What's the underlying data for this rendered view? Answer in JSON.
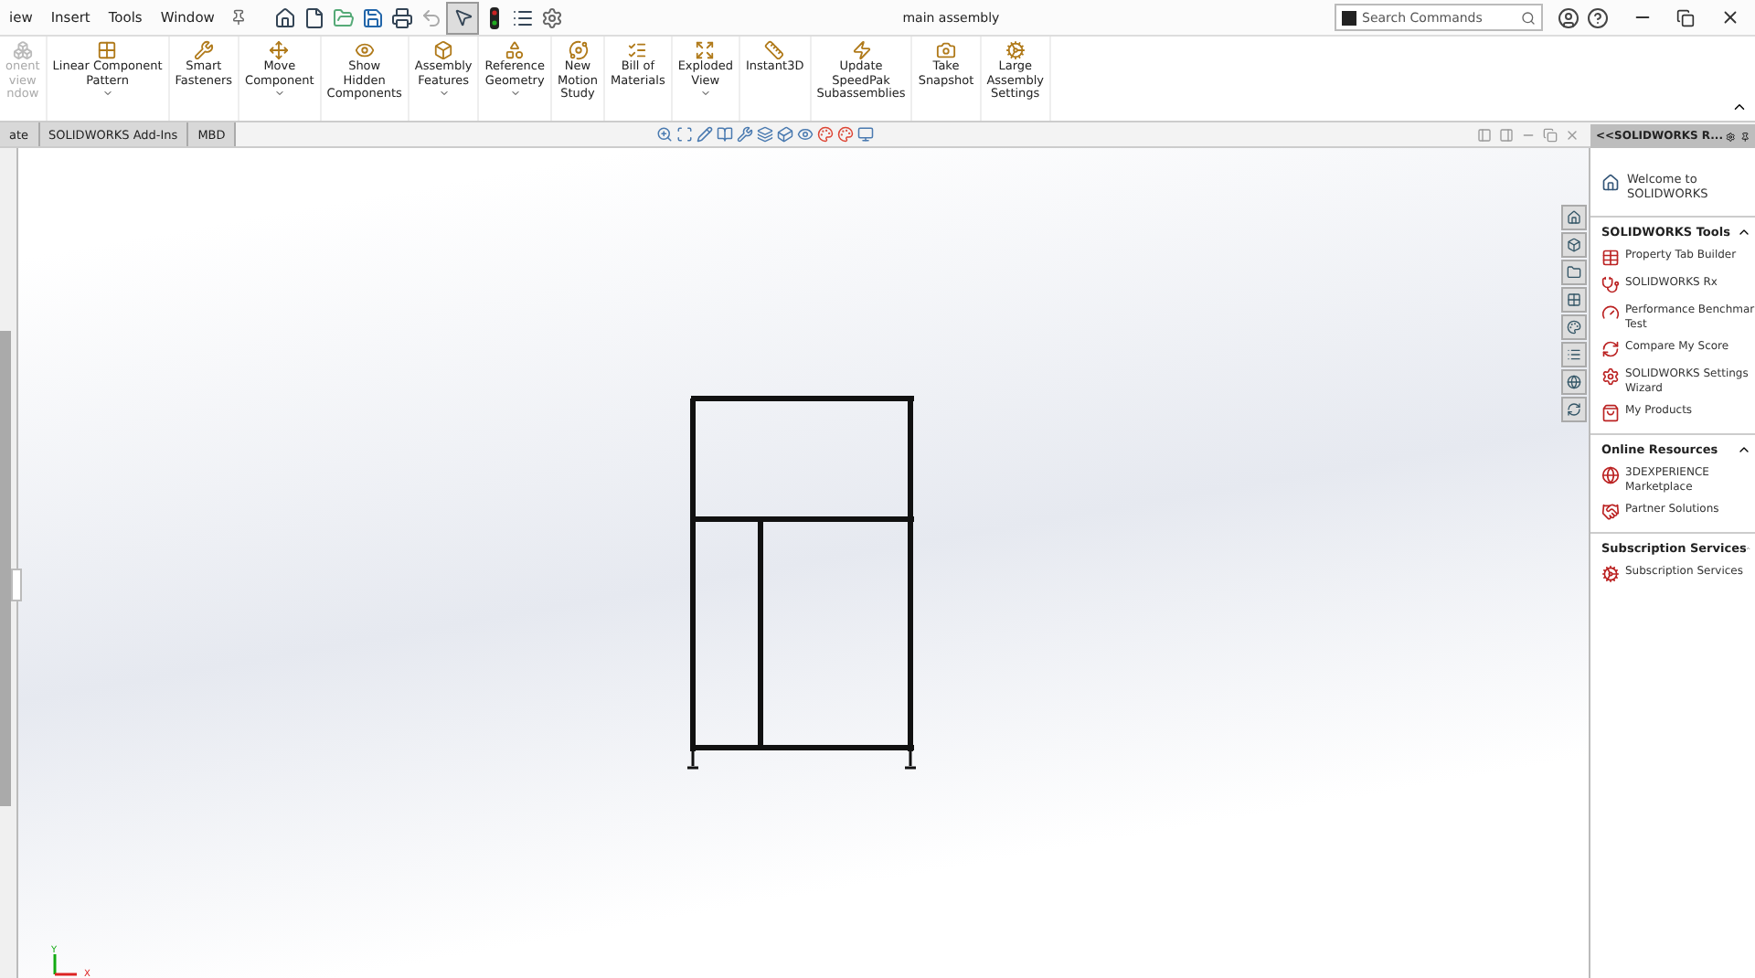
{
  "menu": [
    "iew",
    "Insert",
    "Tools",
    "Window"
  ],
  "window": {
    "title": "main assembly",
    "search": {
      "placeholder": "Search Commands"
    }
  },
  "ribbon": [
    {
      "label": "onent\nview\nndow",
      "disabled": true,
      "dropdown": false
    },
    {
      "label": "Linear Component\nPattern",
      "disabled": false,
      "dropdown": true
    },
    {
      "label": "Smart\nFasteners",
      "disabled": false,
      "dropdown": false
    },
    {
      "label": "Move\nComponent",
      "disabled": false,
      "dropdown": true
    },
    {
      "label": "Show\nHidden\nComponents",
      "disabled": false,
      "dropdown": false
    },
    {
      "label": "Assembly\nFeatures",
      "disabled": false,
      "dropdown": true
    },
    {
      "label": "Reference\nGeometry",
      "disabled": false,
      "dropdown": true
    },
    {
      "label": "New\nMotion\nStudy",
      "disabled": false,
      "dropdown": false
    },
    {
      "label": "Bill of\nMaterials",
      "disabled": false,
      "dropdown": false
    },
    {
      "label": "Exploded\nView",
      "disabled": false,
      "dropdown": true
    },
    {
      "label": "Instant3D",
      "disabled": false,
      "dropdown": false
    },
    {
      "label": "Update\nSpeedPak\nSubassemblies",
      "disabled": false,
      "dropdown": false
    },
    {
      "label": "Take\nSnapshot",
      "disabled": false,
      "dropdown": false
    },
    {
      "label": "Large\nAssembly\nSettings",
      "disabled": false,
      "dropdown": false
    }
  ],
  "tabs": [
    "ate",
    "SOLIDWORKS Add-Ins",
    "MBD"
  ],
  "task_pane": {
    "title": "<<SOLIDWORKS R...",
    "welcome": "Welcome to\nSOLIDWORKS",
    "sections": [
      {
        "title": "SOLIDWORKS Tools",
        "items": [
          "Property Tab Builder",
          "SOLIDWORKS Rx",
          "Performance Benchmar\nTest",
          "Compare My Score",
          "SOLIDWORKS Settings\nWizard",
          "My Products"
        ]
      },
      {
        "title": "Online Resources",
        "items": [
          "3DEXPERIENCE\nMarketplace",
          "Partner Solutions"
        ]
      },
      {
        "title": "Subscription Services",
        "items": [
          "Subscription Services"
        ]
      }
    ]
  },
  "triad": {
    "y": "Y",
    "x": "X"
  }
}
